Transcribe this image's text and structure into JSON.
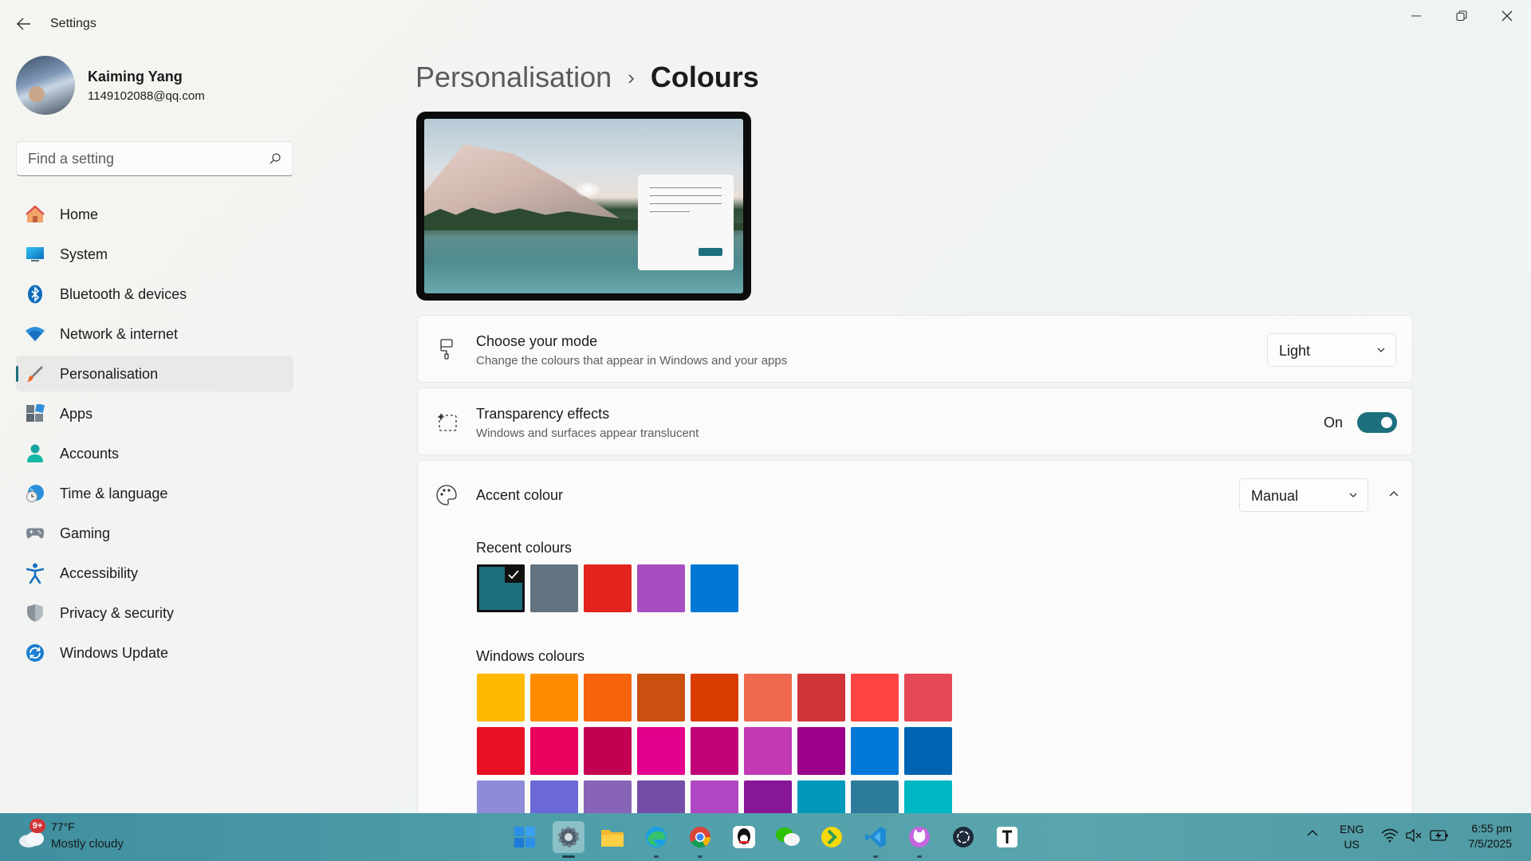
{
  "window": {
    "title": "Settings"
  },
  "profile": {
    "name": "Kaiming Yang",
    "email": "1149102088@qq.com"
  },
  "search": {
    "placeholder": "Find a setting"
  },
  "sidebar": {
    "items": [
      {
        "label": "Home",
        "icon": "home-icon"
      },
      {
        "label": "System",
        "icon": "monitor-icon"
      },
      {
        "label": "Bluetooth & devices",
        "icon": "bluetooth-icon"
      },
      {
        "label": "Network & internet",
        "icon": "wifi-icon"
      },
      {
        "label": "Personalisation",
        "icon": "paintbrush-icon",
        "active": true
      },
      {
        "label": "Apps",
        "icon": "apps-icon"
      },
      {
        "label": "Accounts",
        "icon": "person-icon"
      },
      {
        "label": "Time & language",
        "icon": "globe-clock-icon"
      },
      {
        "label": "Gaming",
        "icon": "gamepad-icon"
      },
      {
        "label": "Accessibility",
        "icon": "accessibility-icon"
      },
      {
        "label": "Privacy & security",
        "icon": "shield-icon"
      },
      {
        "label": "Windows Update",
        "icon": "update-icon"
      }
    ]
  },
  "breadcrumb": {
    "parent": "Personalisation",
    "separator": "›",
    "current": "Colours"
  },
  "mode_card": {
    "title": "Choose your mode",
    "description": "Change the colours that appear in Windows and your apps",
    "value": "Light"
  },
  "transparency_card": {
    "title": "Transparency effects",
    "description": "Windows and surfaces appear translucent",
    "state_label": "On",
    "enabled": true
  },
  "accent_card": {
    "title": "Accent colour",
    "value": "Manual",
    "expanded": true,
    "recent_label": "Recent colours",
    "recent_colours": [
      "#1d6f7e",
      "#637380",
      "#e3241e",
      "#a64dbf",
      "#0078d4"
    ],
    "selected_recent_index": 0,
    "windows_label": "Windows colours",
    "windows_colours": [
      [
        "#ffb900",
        "#ff8c00",
        "#f7630c",
        "#ca5010",
        "#da3b01",
        "#ef6950",
        "#d13438",
        "#ff4343",
        "#e74856"
      ],
      [
        "#e81123",
        "#ea005e",
        "#c30052",
        "#e3008c",
        "#bf0077",
        "#c239b3",
        "#9a0089",
        "#0078d7",
        "#0063b1"
      ],
      [
        "#8e8cd8",
        "#6b69d6",
        "#8764b8",
        "#744da9",
        "#b146c2",
        "#881798",
        "#0099bc",
        "#2d7d9a",
        "#00b7c3"
      ]
    ]
  },
  "taskbar": {
    "weather": {
      "badge": "9+",
      "temp": "77°F",
      "condition": "Mostly cloudy"
    },
    "apps": [
      {
        "name": "start-icon"
      },
      {
        "name": "settings-app-icon",
        "active": true
      },
      {
        "name": "file-explorer-icon"
      },
      {
        "name": "edge-icon"
      },
      {
        "name": "chrome-icon"
      },
      {
        "name": "qq-icon"
      },
      {
        "name": "wechat-icon"
      },
      {
        "name": "music-app-icon"
      },
      {
        "name": "vscode-icon"
      },
      {
        "name": "cat-app-icon"
      },
      {
        "name": "chatgpt-icon"
      },
      {
        "name": "typora-icon"
      }
    ],
    "lang_line1": "ENG",
    "lang_line2": "US",
    "time": "6:55 pm",
    "date": "7/5/2025"
  },
  "colors": {
    "accent": "#1d6f7e"
  }
}
